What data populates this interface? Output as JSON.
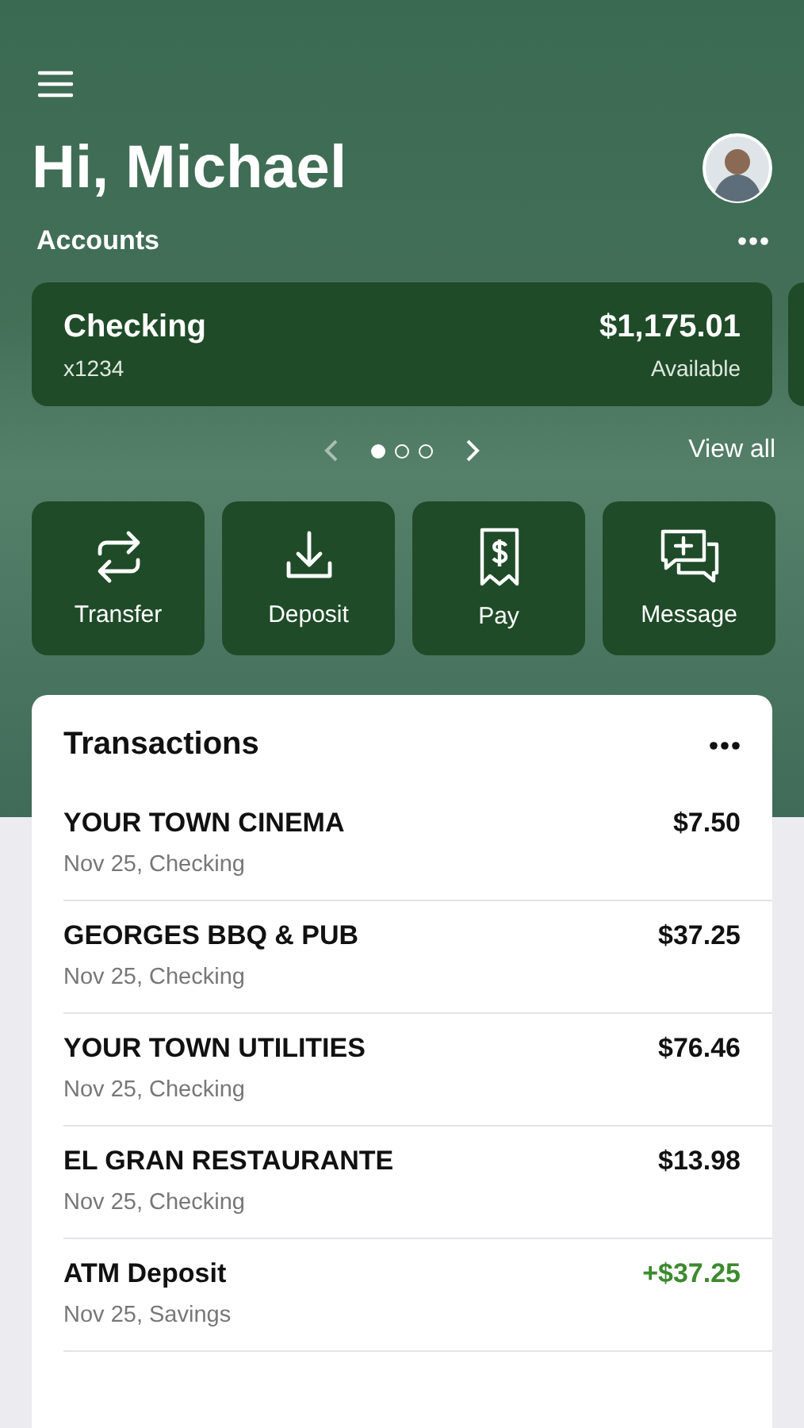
{
  "greeting": "Hi, Michael",
  "accounts": {
    "title": "Accounts",
    "cards": [
      {
        "name": "Checking",
        "number": "x1234",
        "balance": "$1,175.01",
        "balance_label": "Available"
      }
    ],
    "pager": [
      {
        "selected": true
      },
      {
        "selected": false
      },
      {
        "selected": false
      }
    ],
    "view_all": "View all"
  },
  "actions": [
    {
      "kind": "transfer",
      "label": "Transfer"
    },
    {
      "kind": "deposit",
      "label": "Deposit"
    },
    {
      "kind": "pay",
      "label": "Pay"
    },
    {
      "kind": "message",
      "label": "Message"
    }
  ],
  "transactions": {
    "title": "Transactions",
    "rows": [
      {
        "name": "YOUR TOWN CINEMA",
        "detail": "Nov 25, Checking",
        "amount": "$7.50",
        "kind": "debit"
      },
      {
        "name": "GEORGES BBQ & PUB",
        "detail": "Nov 25, Checking",
        "amount": "$37.25",
        "kind": "debit"
      },
      {
        "name": "YOUR TOWN UTILITIES",
        "detail": "Nov 25, Checking",
        "amount": "$76.46",
        "kind": "debit"
      },
      {
        "name": "EL GRAN RESTAURANTE",
        "detail": "Nov 25, Checking",
        "amount": "$13.98",
        "kind": "debit"
      },
      {
        "name": "ATM Deposit",
        "detail": "Nov 25, Savings",
        "amount": "+$37.25",
        "kind": "credit"
      }
    ]
  }
}
